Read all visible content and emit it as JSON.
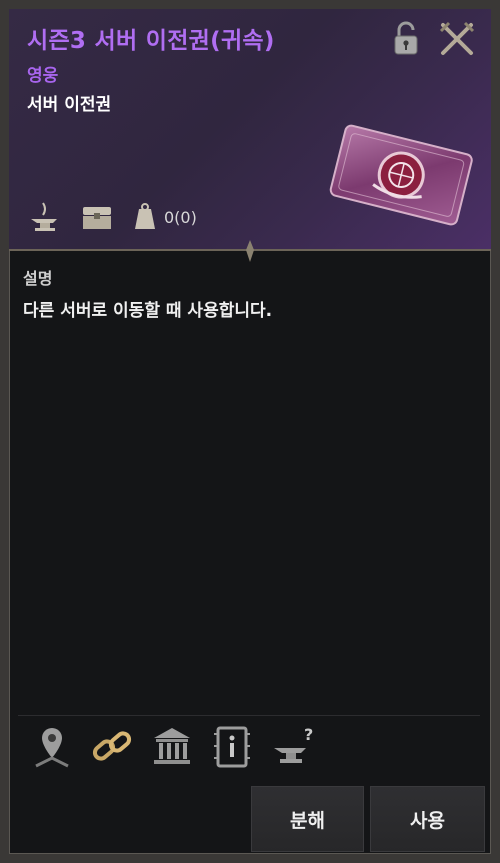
{
  "item": {
    "title": "시즌3 서버 이전권(귀속)",
    "grade": "영웅",
    "type": "서버 이전권",
    "weight": "0(0)"
  },
  "description": {
    "heading": "설명",
    "text": "다른 서버로 이동할 때 사용합니다."
  },
  "buttons": {
    "dismantle": "분해",
    "use": "사용"
  },
  "icons": {
    "lock": "unlocked-padlock-icon",
    "close": "close-swords-icon",
    "anvil": "anvil-icon",
    "chest": "storage-chest-icon",
    "weight": "weight-icon",
    "location": "location-pin-icon",
    "link": "chain-link-icon",
    "bank": "bank-icon",
    "info": "info-tag-icon",
    "anvil_question": "anvil-question-icon"
  },
  "colors": {
    "title": "#b06ef2",
    "grade": "#a865ee",
    "header_bg": "#352a45",
    "panel_bg": "#141517"
  }
}
